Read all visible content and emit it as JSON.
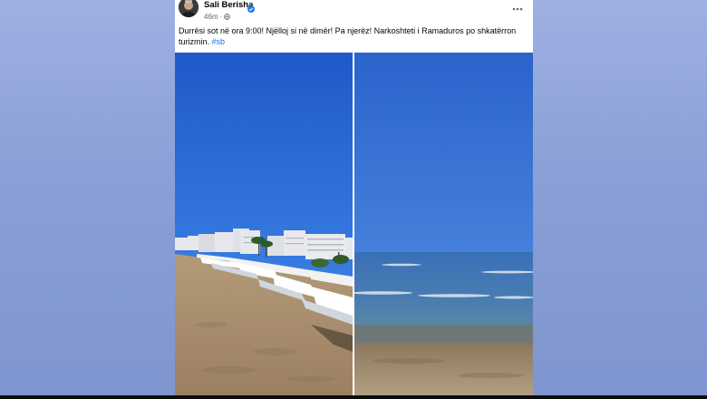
{
  "post": {
    "author": "Sali Berisha",
    "time": "46m",
    "dot": "·",
    "text": "Durrësi sot në ora 9:00! Njëlloj si në dimër! Pa njerëz! Narkoshteti i Ramaduros po shkatërron turizmin.",
    "hashtag": "#sb",
    "verified_color": "#1877f2",
    "icons": {
      "verified": "verified-badge-icon",
      "privacy": "globe-icon",
      "more": "more-dots-icon"
    }
  },
  "photos": [
    {
      "name": "photo-beach-loungers",
      "subject": "beach with sun loungers and hotels"
    },
    {
      "name": "photo-sea-view",
      "subject": "calm sea and sand"
    }
  ]
}
